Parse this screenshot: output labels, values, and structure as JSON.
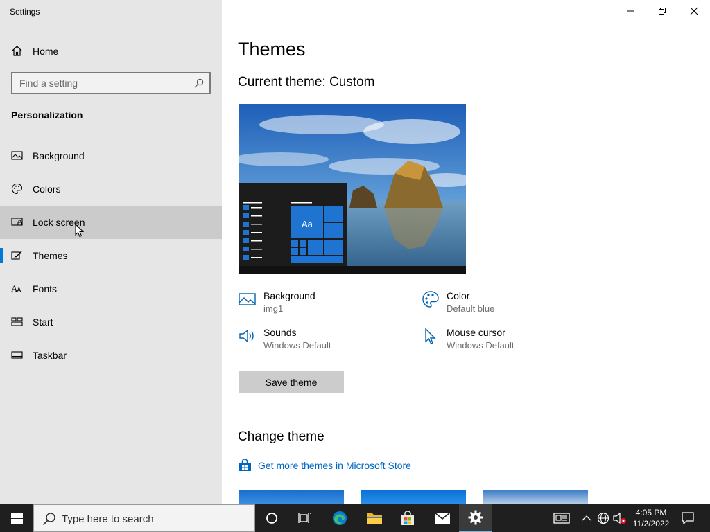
{
  "window": {
    "title": "Settings"
  },
  "sidebar": {
    "home_label": "Home",
    "search_placeholder": "Find a setting",
    "section_title": "Personalization",
    "items": [
      {
        "label": "Background",
        "icon": "image-icon"
      },
      {
        "label": "Colors",
        "icon": "palette-icon"
      },
      {
        "label": "Lock screen",
        "icon": "lock-screen-icon",
        "state": "hover"
      },
      {
        "label": "Themes",
        "icon": "themes-icon",
        "state": "selected"
      },
      {
        "label": "Fonts",
        "icon": "fonts-icon"
      },
      {
        "label": "Start",
        "icon": "start-icon"
      },
      {
        "label": "Taskbar",
        "icon": "taskbar-icon"
      }
    ]
  },
  "main": {
    "title": "Themes",
    "current_theme": "Current theme: Custom",
    "attributes": {
      "background": {
        "label": "Background",
        "value": "img1"
      },
      "color": {
        "label": "Color",
        "value": "Default blue"
      },
      "sounds": {
        "label": "Sounds",
        "value": "Windows Default"
      },
      "mouse_cursor": {
        "label": "Mouse cursor",
        "value": "Windows Default"
      }
    },
    "save_button": "Save theme",
    "change_theme_title": "Change theme",
    "store_link": "Get more themes in Microsoft Store",
    "preview_tile_label": "Aa"
  },
  "taskbar": {
    "search_placeholder": "Type here to search",
    "time": "4:05 PM",
    "date": "11/2/2022"
  },
  "colors": {
    "accent": "#0078d7",
    "link": "#0067c0",
    "sidebar_bg": "#e6e6e6",
    "taskbar_bg": "#1f1f1f"
  }
}
